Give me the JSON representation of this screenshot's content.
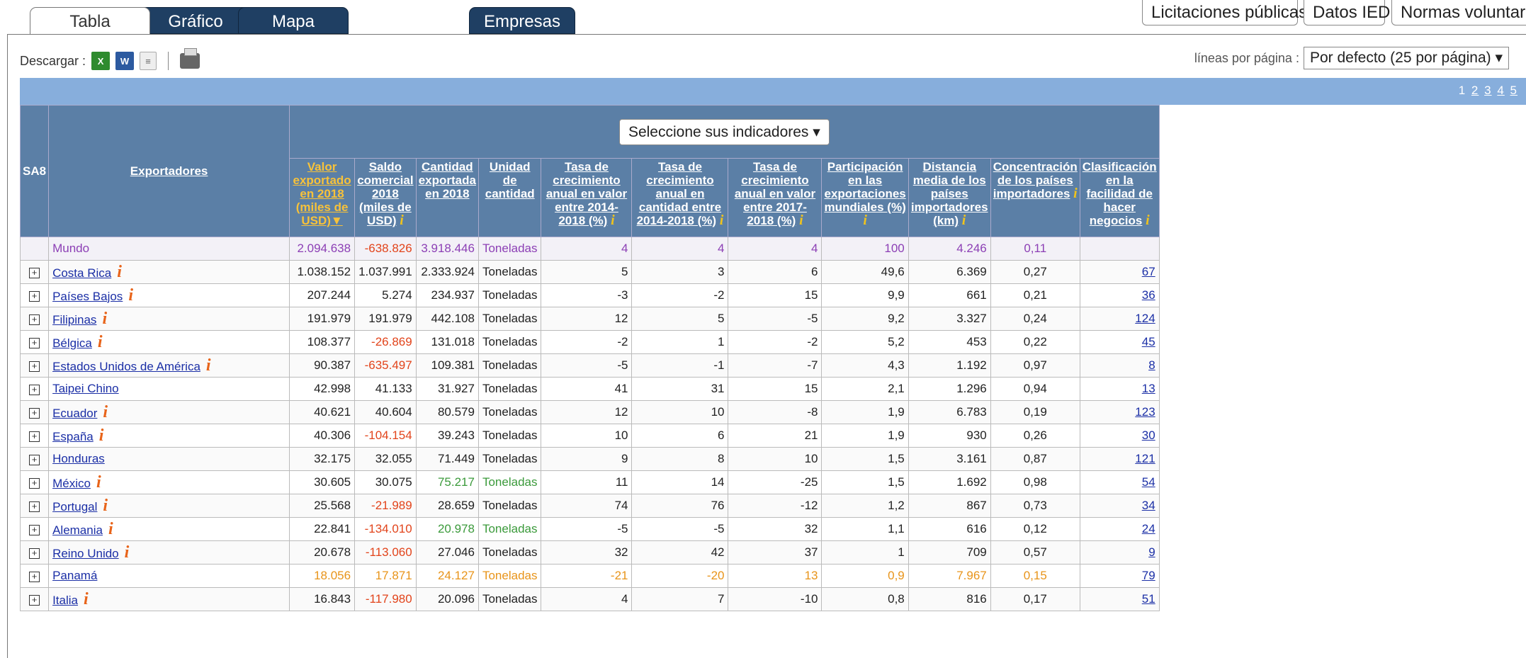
{
  "tabs": {
    "tabla": "Tabla",
    "grafico": "Gráfico",
    "mapa": "Mapa",
    "empresas": "Empresas"
  },
  "top_buttons": {
    "licitaciones": "Licitaciones públicas",
    "datos_ied": "Datos IED",
    "normas": "Normas voluntarias"
  },
  "download": {
    "label": "Descargar :"
  },
  "per_page": {
    "label": "líneas por página :",
    "value": "Por defecto (25 por página) ▾"
  },
  "pager": {
    "pages": [
      "1",
      "2",
      "3",
      "4",
      "5"
    ]
  },
  "table": {
    "col_sa8": "SA8",
    "col_exportadores": "Exportadores",
    "select_indicators": "Seleccione sus indicadores ▾",
    "columns": [
      "Valor exportado en 2018 (miles de USD)▼",
      "Saldo comercial 2018 (miles de USD)",
      "Cantidad exportada en 2018",
      "Unidad de cantidad",
      "Tasa de crecimiento anual en valor entre 2014-2018 (%)",
      "Tasa de crecimiento anual en cantidad entre 2014-2018 (%)",
      "Tasa de crecimiento anual en valor entre 2017-2018 (%)",
      "Participación en las exportaciones mundiales (%)",
      "Distancia media de los países importadores (km)",
      "Concentración de los países importadores",
      "Clasificación en la facilidad de hacer negocios"
    ],
    "info_icon": "i",
    "rows": [
      {
        "name": "Mundo",
        "valor": "2.094.638",
        "saldo": "-638.826",
        "cantidad": "3.918.446",
        "unidad": "Toneladas",
        "t1": "4",
        "t2": "4",
        "t3": "4",
        "part": "100",
        "dist": "4.246",
        "conc": "0,11",
        "clas": ""
      },
      {
        "name": "Costa Rica",
        "valor": "1.038.152",
        "saldo": "1.037.991",
        "cantidad": "2.333.924",
        "unidad": "Toneladas",
        "t1": "5",
        "t2": "3",
        "t3": "6",
        "part": "49,6",
        "dist": "6.369",
        "conc": "0,27",
        "clas": "67"
      },
      {
        "name": "Países Bajos",
        "valor": "207.244",
        "saldo": "5.274",
        "cantidad": "234.937",
        "unidad": "Toneladas",
        "t1": "-3",
        "t2": "-2",
        "t3": "15",
        "part": "9,9",
        "dist": "661",
        "conc": "0,21",
        "clas": "36"
      },
      {
        "name": "Filipinas",
        "valor": "191.979",
        "saldo": "191.979",
        "cantidad": "442.108",
        "unidad": "Toneladas",
        "t1": "12",
        "t2": "5",
        "t3": "-5",
        "part": "9,2",
        "dist": "3.327",
        "conc": "0,24",
        "clas": "124"
      },
      {
        "name": "Bélgica",
        "valor": "108.377",
        "saldo": "-26.869",
        "cantidad": "131.018",
        "unidad": "Toneladas",
        "t1": "-2",
        "t2": "1",
        "t3": "-2",
        "part": "5,2",
        "dist": "453",
        "conc": "0,22",
        "clas": "45"
      },
      {
        "name": "Estados Unidos de América",
        "valor": "90.387",
        "saldo": "-635.497",
        "cantidad": "109.381",
        "unidad": "Toneladas",
        "t1": "-5",
        "t2": "-1",
        "t3": "-7",
        "part": "4,3",
        "dist": "1.192",
        "conc": "0,97",
        "clas": "8"
      },
      {
        "name": "Taipei Chino",
        "valor": "42.998",
        "saldo": "41.133",
        "cantidad": "31.927",
        "unidad": "Toneladas",
        "t1": "41",
        "t2": "31",
        "t3": "15",
        "part": "2,1",
        "dist": "1.296",
        "conc": "0,94",
        "clas": "13"
      },
      {
        "name": "Ecuador",
        "valor": "40.621",
        "saldo": "40.604",
        "cantidad": "80.579",
        "unidad": "Toneladas",
        "t1": "12",
        "t2": "10",
        "t3": "-8",
        "part": "1,9",
        "dist": "6.783",
        "conc": "0,19",
        "clas": "123"
      },
      {
        "name": "España",
        "valor": "40.306",
        "saldo": "-104.154",
        "cantidad": "39.243",
        "unidad": "Toneladas",
        "t1": "10",
        "t2": "6",
        "t3": "21",
        "part": "1,9",
        "dist": "930",
        "conc": "0,26",
        "clas": "30"
      },
      {
        "name": "Honduras",
        "valor": "32.175",
        "saldo": "32.055",
        "cantidad": "71.449",
        "unidad": "Toneladas",
        "t1": "9",
        "t2": "8",
        "t3": "10",
        "part": "1,5",
        "dist": "3.161",
        "conc": "0,87",
        "clas": "121"
      },
      {
        "name": "México",
        "valor": "30.605",
        "saldo": "30.075",
        "cantidad": "75.217",
        "unidad": "Toneladas",
        "t1": "11",
        "t2": "14",
        "t3": "-25",
        "part": "1,5",
        "dist": "1.692",
        "conc": "0,98",
        "clas": "54"
      },
      {
        "name": "Portugal",
        "valor": "25.568",
        "saldo": "-21.989",
        "cantidad": "28.659",
        "unidad": "Toneladas",
        "t1": "74",
        "t2": "76",
        "t3": "-12",
        "part": "1,2",
        "dist": "867",
        "conc": "0,73",
        "clas": "34"
      },
      {
        "name": "Alemania",
        "valor": "22.841",
        "saldo": "-134.010",
        "cantidad": "20.978",
        "unidad": "Toneladas",
        "t1": "-5",
        "t2": "-5",
        "t3": "32",
        "part": "1,1",
        "dist": "616",
        "conc": "0,12",
        "clas": "24"
      },
      {
        "name": "Reino Unido",
        "valor": "20.678",
        "saldo": "-113.060",
        "cantidad": "27.046",
        "unidad": "Toneladas",
        "t1": "32",
        "t2": "42",
        "t3": "37",
        "part": "1",
        "dist": "709",
        "conc": "0,57",
        "clas": "9"
      },
      {
        "name": "Panamá",
        "valor": "18.056",
        "saldo": "17.871",
        "cantidad": "24.127",
        "unidad": "Toneladas",
        "t1": "-21",
        "t2": "-20",
        "t3": "13",
        "part": "0,9",
        "dist": "7.967",
        "conc": "0,15",
        "clas": "79"
      },
      {
        "name": "Italia",
        "valor": "16.843",
        "saldo": "-117.980",
        "cantidad": "20.096",
        "unidad": "Toneladas",
        "t1": "4",
        "t2": "7",
        "t3": "-10",
        "part": "0,8",
        "dist": "816",
        "conc": "0,17",
        "clas": "51"
      }
    ]
  },
  "colors": {
    "header_bg": "#5b7fa6",
    "bluebar": "#87aedc",
    "negative": "#e2441b",
    "world": "#8c3fb5",
    "sorted_col": "#f7c23a",
    "info": "#e8641a"
  }
}
